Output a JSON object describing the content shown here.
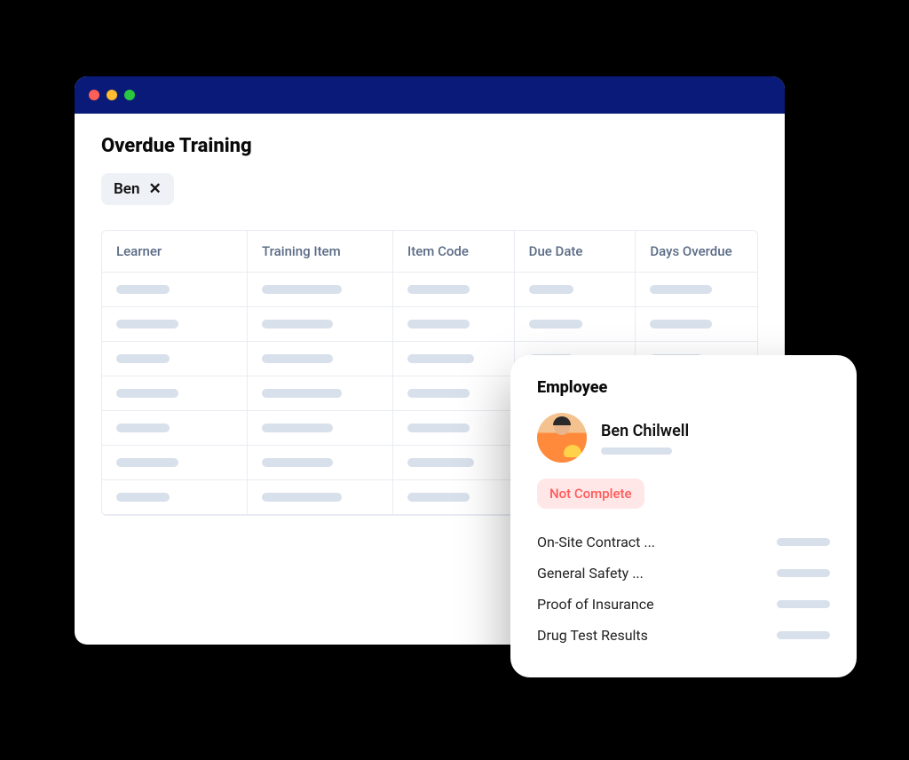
{
  "page": {
    "title": "Overdue Training"
  },
  "filter": {
    "label": "Ben"
  },
  "table": {
    "columns": [
      "Learner",
      "Training Item",
      "Item Code",
      "Due Date",
      "Days Overdue"
    ],
    "row_count": 7
  },
  "popover": {
    "heading": "Employee",
    "employee_name": "Ben Chilwell",
    "status": "Not Complete",
    "items": [
      "On-Site Contract ...",
      "General Safety ...",
      "Proof of Insurance",
      "Drug Test Results"
    ]
  }
}
